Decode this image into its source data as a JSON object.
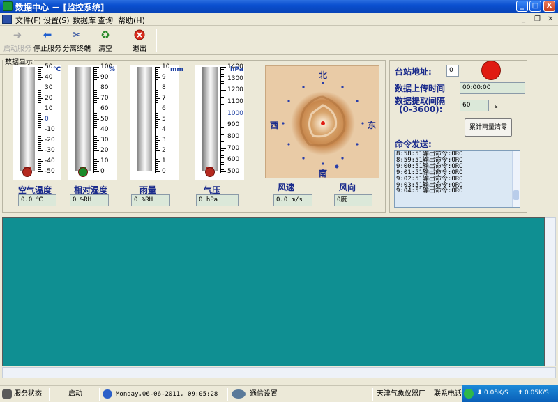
{
  "window": {
    "title": "数据中心 － [监控系统]",
    "buttons": {
      "minimize": "_",
      "maximize": "□",
      "close": "X"
    }
  },
  "menu": [
    {
      "label": "文件(F)"
    },
    {
      "label": "设置(S)"
    },
    {
      "label": "数据库"
    },
    {
      "label": "查询"
    },
    {
      "label": "帮助(H)"
    }
  ],
  "mdi_buttons": {
    "minimize": "_",
    "restore": "❐",
    "close": "✕"
  },
  "toolbar": {
    "start": "启动服务",
    "stop": "停止服务",
    "detach": "分离终端",
    "clear": "清空",
    "exit": "退出"
  },
  "panel": {
    "label": "数据显示"
  },
  "gauges": {
    "temp": {
      "unit": "°C",
      "ticks": [
        "50",
        "40",
        "30",
        "20",
        "10",
        "0",
        "-10",
        "-20",
        "-30",
        "-40",
        "-50"
      ],
      "label": "空气温度",
      "value": "0.0 ℃",
      "level": 0
    },
    "humidity": {
      "unit": "%",
      "ticks": [
        "100",
        "90",
        "80",
        "70",
        "60",
        "50",
        "40",
        "30",
        "20",
        "10",
        "0"
      ],
      "label": "相对湿度",
      "value": "0 %RH",
      "level": 0
    },
    "rain": {
      "unit": "mm",
      "ticks": [
        "10",
        "9",
        "8",
        "7",
        "6",
        "5",
        "4",
        "3",
        "2",
        "1",
        "0"
      ],
      "label": "雨量",
      "value": "0 %RH",
      "level": 0
    },
    "pressure": {
      "unit": "hPa",
      "ticks": [
        "1400",
        "1300",
        "1200",
        "1100",
        "1000",
        "900",
        "800",
        "700",
        "600",
        "500"
      ],
      "label": "气压",
      "value": "0 hPa",
      "level": 0
    }
  },
  "wind": {
    "north": "北",
    "south": "南",
    "west": "西",
    "east": "东",
    "speed_label": "风速",
    "speed_value": "0.0 m/s",
    "dir_label": "风向",
    "dir_value": "0度"
  },
  "station": {
    "address_label": "台站地址:",
    "address_value": "0",
    "upload_label": "数据上传时间",
    "upload_value": "00:00:00",
    "interval_label": "数据提取间隔",
    "interval_range": "(0-3600):",
    "interval_value": "60",
    "interval_unit": "s",
    "reset_button": "累计雨量清零",
    "status_color": "#e01b12"
  },
  "command": {
    "label": "命令发送:",
    "log": [
      "8:58:51输出命令:ORO",
      "8:59:51输出命令:ORO",
      "9:00:51输出命令:ORO",
      "9:01:51输出命令:ORO",
      "9:02:51输出命令:ORO",
      "9:03:51输出命令:ORO",
      "9:04:51输出命令:ORO"
    ]
  },
  "statusbar": {
    "service_label": "服务状态",
    "service_value": "启动",
    "datetime": "Monday,06-06-2011, 09:05:28",
    "comm": "通信设置",
    "company": "天津气象仪器厂",
    "contact": "联系电话"
  },
  "tray": {
    "down": "0.05K/S",
    "up": "0.05K/S"
  },
  "colors": {
    "display_area": "#0f8f92"
  }
}
